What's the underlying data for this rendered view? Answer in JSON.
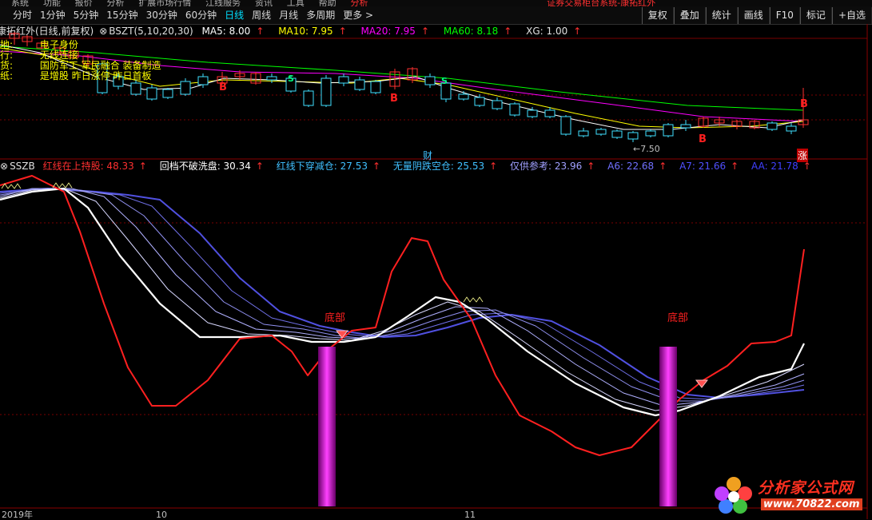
{
  "menubar": [
    "系统",
    "功能",
    "报价",
    "分析",
    "扩展市场行情",
    "江线服务",
    "资讯",
    "工具",
    "帮助",
    "分析",
    "证券交易柜台系统-康拓红外"
  ],
  "toolbar": {
    "tabs": [
      "分时",
      "1分钟",
      "5分钟",
      "15分钟",
      "30分钟",
      "60分钟",
      "日线",
      "周线",
      "月线",
      "多周期",
      "更多 >"
    ],
    "active_tab": "日线",
    "tools": [
      "复权",
      "叠加",
      "统计",
      "画线",
      "F10",
      "标记",
      "+自选"
    ]
  },
  "main_chart": {
    "title": "康拓红外(日线,前复权)",
    "indicator": "BSZT(5,10,20,30)",
    "ma5_label": "MA5: 8.00",
    "ma10_label": "MA10: 7.95",
    "ma20_label": "MA20: 7.95",
    "ma60_label": "MA60: 8.18",
    "xg_label": "XG: 1.00",
    "up_arrow": "↑",
    "left_texts": [
      "地:",
      "行:",
      "货:",
      "纸:"
    ],
    "notes": [
      "电子身份",
      "无线连接",
      "国防军工 军民融合 装备制造",
      "是增股 昨日涨停 昨日首板"
    ],
    "markers": {
      "b1": "B",
      "b2": "B",
      "b3": "B",
      "b4": "B",
      "s1": "S",
      "s2": "S"
    },
    "price_note": "←7.50",
    "cai_label": "财",
    "zhang_label": "涨",
    "colors": {
      "ma5": "#ffffff",
      "ma10": "#ffff00",
      "ma20": "#ff00ff",
      "ma60": "#00ff00",
      "candle_up": "#ff3030",
      "candle_down": "#40e0ff"
    }
  },
  "sub_chart": {
    "name": "SSZB",
    "items": [
      {
        "label": "红线在上持股: 48.33",
        "color": "#ff3030"
      },
      {
        "label": "回档不破洗盘: 30.34",
        "color": "#ffffff"
      },
      {
        "label": "红线下穿减仓: 27.53",
        "color": "#40c0ff"
      },
      {
        "label": "无量阴跌空仓: 25.53",
        "color": "#40c0ff"
      },
      {
        "label": "仅供参考: 23.96",
        "color": "#a0a0ff"
      },
      {
        "label": "A6: 22.68",
        "color": "#8080ff"
      },
      {
        "label": "A7: 21.66",
        "color": "#6060ff"
      },
      {
        "label": "AA: 21.78",
        "color": "#4040ff"
      }
    ],
    "bottom_label_1": "底部",
    "bottom_label_2": "底部",
    "colors": {
      "red_line": "#ff2020",
      "white_line": "#ffffff",
      "band": "#5050e0",
      "bar": "#cc00cc"
    }
  },
  "xaxis": {
    "labels": [
      "2019年",
      "10",
      "11"
    ]
  },
  "watermark": {
    "name": "分析家公式网",
    "url": "www.70822.com"
  }
}
